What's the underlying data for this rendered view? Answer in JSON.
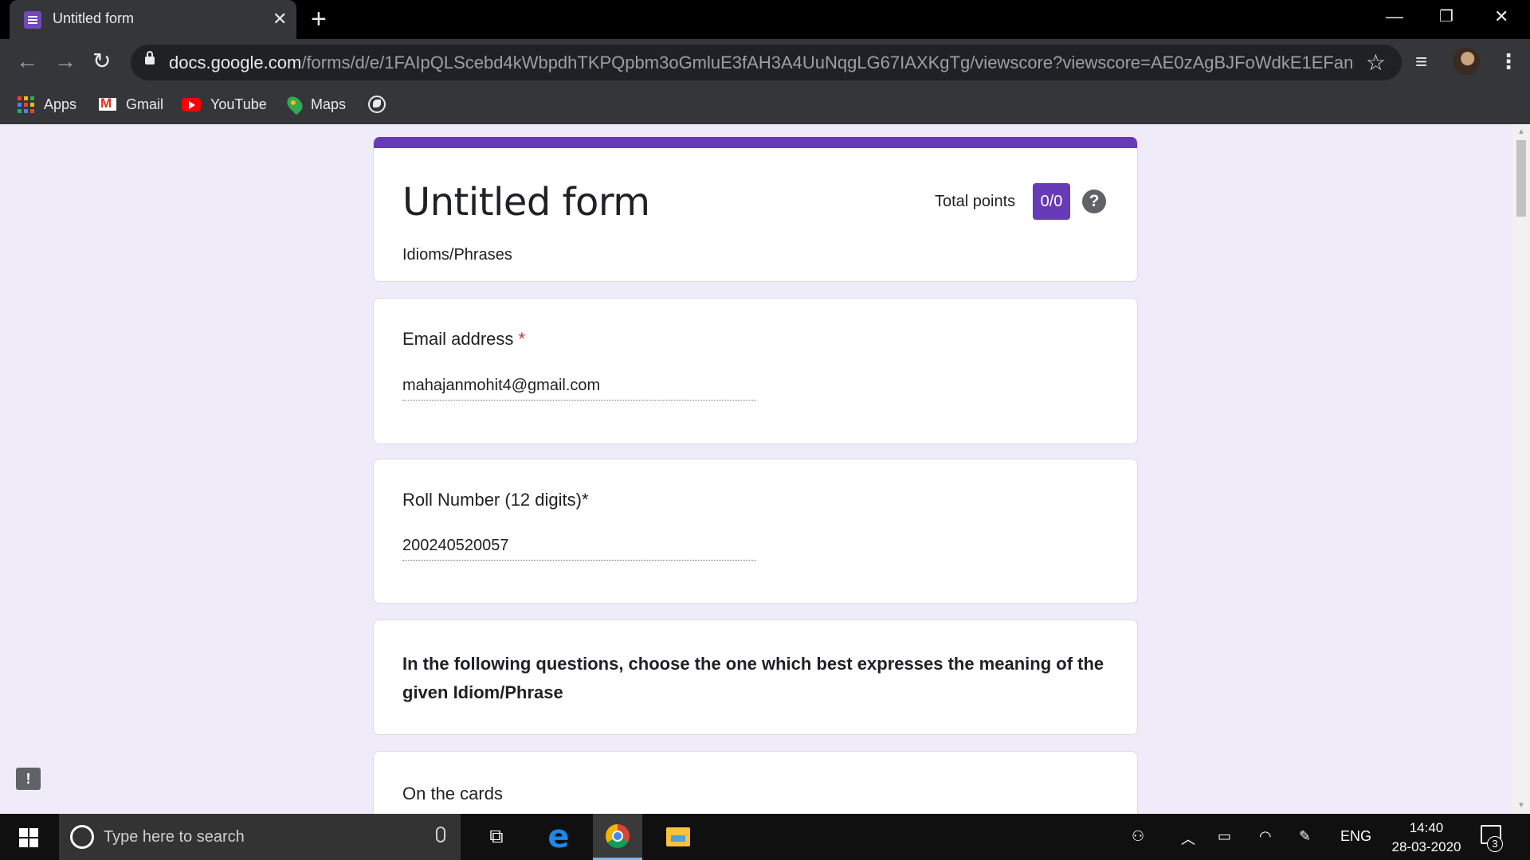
{
  "browser": {
    "tab_title": "Untitled form",
    "url_host": "docs.google.com",
    "url_path": "/forms/d/e/1FAIpQLScebd4kWbpdhTKPQpbm3oGmluE3fAH3A4UuNqgLG67IAXKgTg/viewscore?viewscore=AE0zAgBJFoWdkE1EFanJXh1ZVQT...",
    "bookmarks": [
      "Apps",
      "Gmail",
      "YouTube",
      "Maps"
    ]
  },
  "form": {
    "title": "Untitled form",
    "description": "Idioms/Phrases",
    "total_points_label": "Total points",
    "total_points_value": "0/0",
    "accent_color": "#673ab7",
    "email": {
      "label": "Email address",
      "required_mark": "*",
      "value": "mahajanmohit4@gmail.com"
    },
    "roll": {
      "label": "Roll Number (12 digits)*",
      "value": "200240520057"
    },
    "instruction": "In the following questions, choose the one which best expresses the meaning of the given Idiom/Phrase",
    "question1": {
      "label": "On the cards"
    }
  },
  "taskbar": {
    "search_placeholder": "Type here to search",
    "language": "ENG",
    "time": "14:40",
    "date": "28-03-2020",
    "notification_count": "3"
  }
}
